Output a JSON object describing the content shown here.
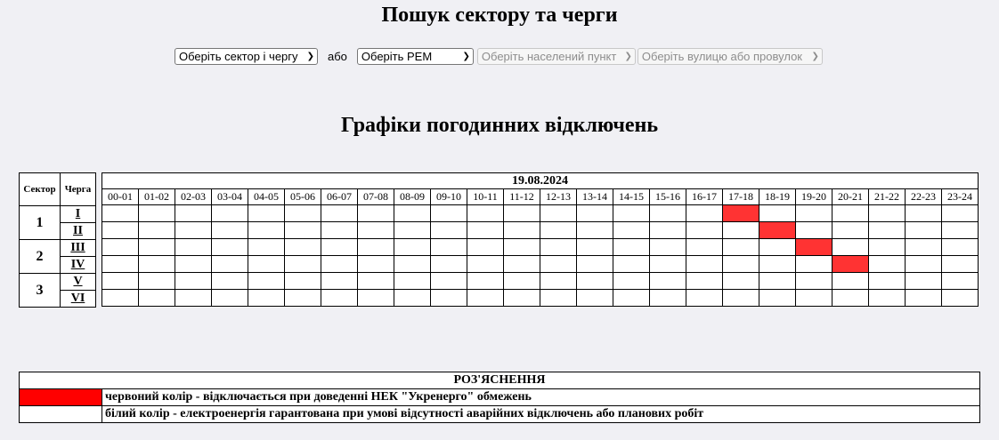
{
  "page": {
    "title": "Пошук сектору та черги",
    "schedule_title": "Графіки погодинних відключень"
  },
  "search": {
    "sector_select": "Оберіть сектор і чергу",
    "or_label": "або",
    "rem_select": "Оберіть РЕМ",
    "locality_select": "Оберіть населений пункт",
    "street_select": "Оберіть вулицю або провулок"
  },
  "schedule": {
    "header_sector": "Сектор",
    "header_queue": "Черга",
    "date": "19.08.2024",
    "hours": [
      "00-01",
      "01-02",
      "02-03",
      "03-04",
      "04-05",
      "05-06",
      "06-07",
      "07-08",
      "08-09",
      "09-10",
      "10-11",
      "11-12",
      "12-13",
      "13-14",
      "14-15",
      "15-16",
      "16-17",
      "17-18",
      "18-19",
      "19-20",
      "20-21",
      "21-22",
      "22-23",
      "23-24"
    ],
    "sectors": [
      "1",
      "2",
      "3"
    ],
    "queues": [
      "I",
      "II",
      "III",
      "IV",
      "V",
      "VI"
    ],
    "outages": [
      {
        "queue": "I",
        "hours": [
          "17-18"
        ]
      },
      {
        "queue": "II",
        "hours": [
          "18-19"
        ]
      },
      {
        "queue": "III",
        "hours": [
          "19-20"
        ]
      },
      {
        "queue": "IV",
        "hours": [
          "20-21"
        ]
      },
      {
        "queue": "V",
        "hours": []
      },
      {
        "queue": "VI",
        "hours": []
      }
    ],
    "outage_color": "#ff3333"
  },
  "legend": {
    "title": "РОЗ'ЯСНЕННЯ",
    "red_text": "червоний колір - відключається при доведенні НЕК \"Укренерго\" обмежень",
    "white_text": "білий колір - електроенергія гарантована при умові відсутності аварійних відключень або планових робіт",
    "red_color": "#ff0000",
    "white_color": "#ffffff"
  }
}
